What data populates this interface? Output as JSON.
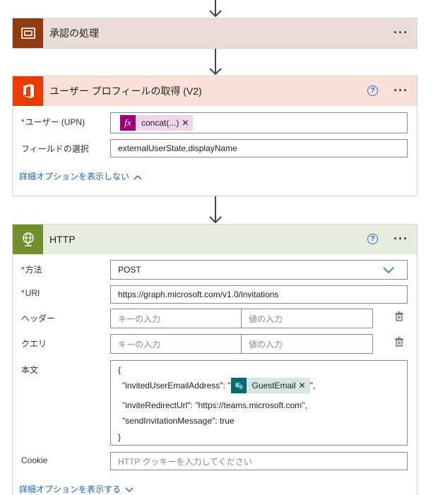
{
  "approval_card": {
    "title": "承認の処理"
  },
  "profile_card": {
    "title": "ユーザー プロフィールの取得 (V2)",
    "user_label": "ユーザー (UPN)",
    "user_token": "concat(...)",
    "fields_label": "フィールドの選択",
    "fields_value": "externalUserState,displayName",
    "advanced_toggle": "詳細オプションを表示しない"
  },
  "http_card": {
    "title": "HTTP",
    "method_label": "方法",
    "method_value": "POST",
    "uri_label": "URI",
    "uri_value": "https://graph.microsoft.com/v1.0/invitations",
    "header_label": "ヘッダー",
    "header_key_placeholder": "キーの入力",
    "header_value_placeholder": "値の入力",
    "query_label": "クエリ",
    "query_key_placeholder": "キーの入力",
    "query_value_placeholder": "値の入力",
    "body_label": "本文",
    "body_line1": "{",
    "body_line2_prefix": "\"invitedUserEmailAddress\": \"",
    "body_token": "GuestEmail",
    "body_line2_suffix": "\",",
    "body_line3": "\"inviteRedirectUrl\": \"https://teams.microsoft.com\",",
    "body_line4": "\"sendInvitationMessage\": true",
    "body_line5": "}",
    "cookie_label": "Cookie",
    "cookie_placeholder": "HTTP クッキーを入力してください",
    "advanced_toggle": "詳細オプションを表示する"
  },
  "colors": {
    "approval_header": "#eaddd7",
    "approval_icon": "#8f3d10",
    "profile_header": "#fbe0d9",
    "profile_icon": "#eb3c00",
    "http_header": "#e6ecde",
    "http_icon": "#70902d",
    "fx_token": "#9b0079",
    "sharepoint_token": "#036c70",
    "link": "#1d5fbf"
  }
}
